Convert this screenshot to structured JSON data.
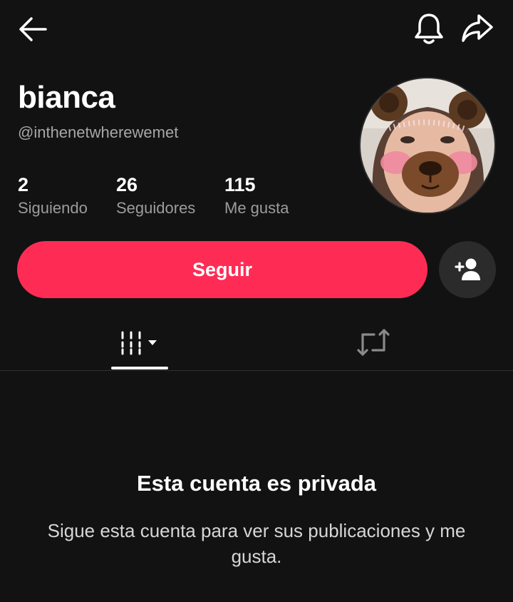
{
  "profile": {
    "name": "bianca",
    "handle": "@inthenetwherewemet"
  },
  "stats": [
    {
      "value": "2",
      "label": "Siguiendo"
    },
    {
      "value": "26",
      "label": "Seguidores"
    },
    {
      "value": "115",
      "label": "Me gusta"
    }
  ],
  "actions": {
    "follow_label": "Seguir"
  },
  "private": {
    "title": "Esta cuenta es privada",
    "subtitle": "Sigue esta cuenta para ver sus publicaciones y me gusta."
  },
  "colors": {
    "background": "#121212",
    "accent": "#fe2c55",
    "secondary_button": "#2b2b2b"
  },
  "icons": [
    "back-arrow-icon",
    "bell-icon",
    "share-icon",
    "add-user-icon",
    "videos-grid-icon",
    "repost-icon"
  ]
}
